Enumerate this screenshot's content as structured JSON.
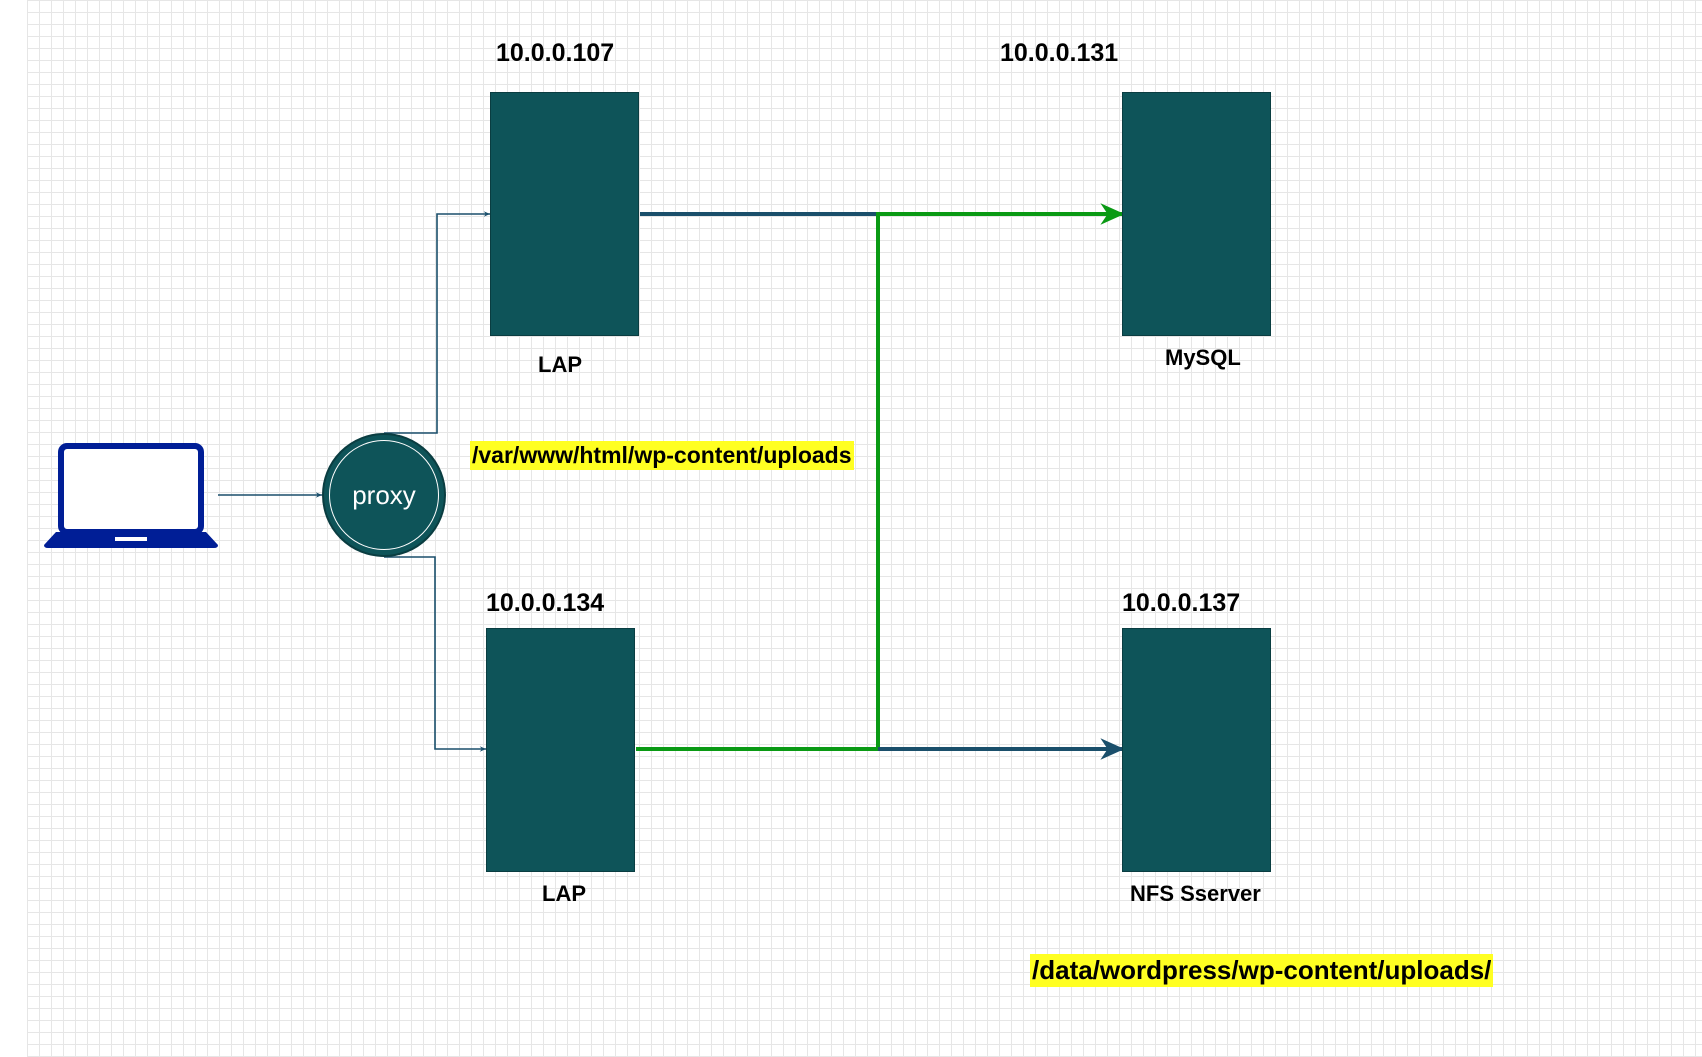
{
  "diagram": {
    "nodes": {
      "lap_top": {
        "ip": "10.0.0.107",
        "label": "LAP"
      },
      "lap_bottom": {
        "ip": "10.0.0.134",
        "label": "LAP"
      },
      "mysql": {
        "ip": "10.0.0.131",
        "label": "MySQL"
      },
      "nfs": {
        "ip": "10.0.0.137",
        "label": "NFS Sserver"
      },
      "proxy": {
        "label": "proxy"
      },
      "client": {
        "icon": "laptop-icon"
      }
    },
    "notes": {
      "web_uploads": "/var/www/html/wp-content/uploads",
      "nfs_uploads": "/data/wordpress/wp-content/uploads/"
    },
    "colors": {
      "server": "#0e5459",
      "client": "#001e96",
      "link_dark": "#1a4f6b",
      "link_green": "#0a9a14",
      "highlight": "#ffff22"
    }
  }
}
